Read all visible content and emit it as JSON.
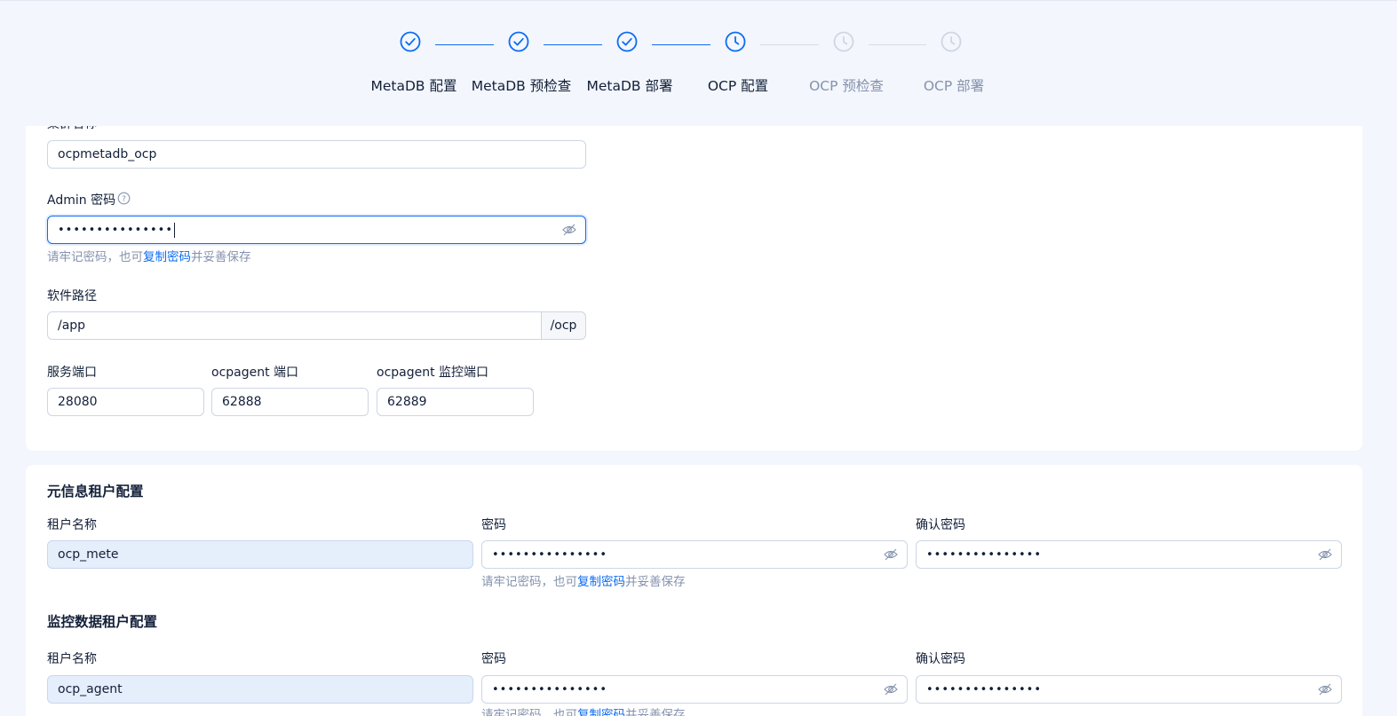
{
  "steps": [
    {
      "label": "MetaDB 配置",
      "status": "done"
    },
    {
      "label": "MetaDB 预检查",
      "status": "done"
    },
    {
      "label": "MetaDB 部署",
      "status": "done"
    },
    {
      "label": "OCP 配置",
      "status": "current"
    },
    {
      "label": "OCP 预检查",
      "status": "wait"
    },
    {
      "label": "OCP 部署",
      "status": "wait"
    }
  ],
  "colors": {
    "primary": "#0d6cf2",
    "wait": "#cfd6e4",
    "text": "#132039",
    "muted": "#8592ad"
  },
  "ocp_config": {
    "cluster_name_label": "集群名称",
    "cluster_name_value": "ocpmetadb_ocp",
    "admin_password_label": "Admin 密码",
    "admin_password_value": "•••••••••••••••",
    "password_hint_prefix": "请牢记密码，也可",
    "password_hint_link": "复制密码",
    "password_hint_suffix": "并妥善保存",
    "software_path_label": "软件路径",
    "software_path_value": "/app",
    "software_path_suffix": "/ocp",
    "service_port_label": "服务端口",
    "service_port_value": "28080",
    "agent_port_label": "ocpagent 端口",
    "agent_port_value": "62888",
    "agent_monitor_port_label": "ocpagent 监控端口",
    "agent_monitor_port_value": "62889"
  },
  "meta_tenant": {
    "title": "元信息租户配置",
    "tenant_name_label": "租户名称",
    "tenant_name_value": "ocp_mete",
    "password_label": "密码",
    "password_value": "•••••••••••••••",
    "confirm_label": "确认密码",
    "confirm_value": "•••••••••••••••",
    "hint_prefix": "请牢记密码，也可",
    "hint_link": "复制密码",
    "hint_suffix": "并妥善保存"
  },
  "monitor_tenant": {
    "title": "监控数据租户配置",
    "tenant_name_label": "租户名称",
    "tenant_name_value": "ocp_agent",
    "password_label": "密码",
    "password_value": "•••••••••••••••",
    "confirm_label": "确认密码",
    "confirm_value": "•••••••••••••••",
    "hint_prefix": "请牢记密码，也可",
    "hint_link": "复制密码",
    "hint_suffix": "并妥善保存"
  }
}
